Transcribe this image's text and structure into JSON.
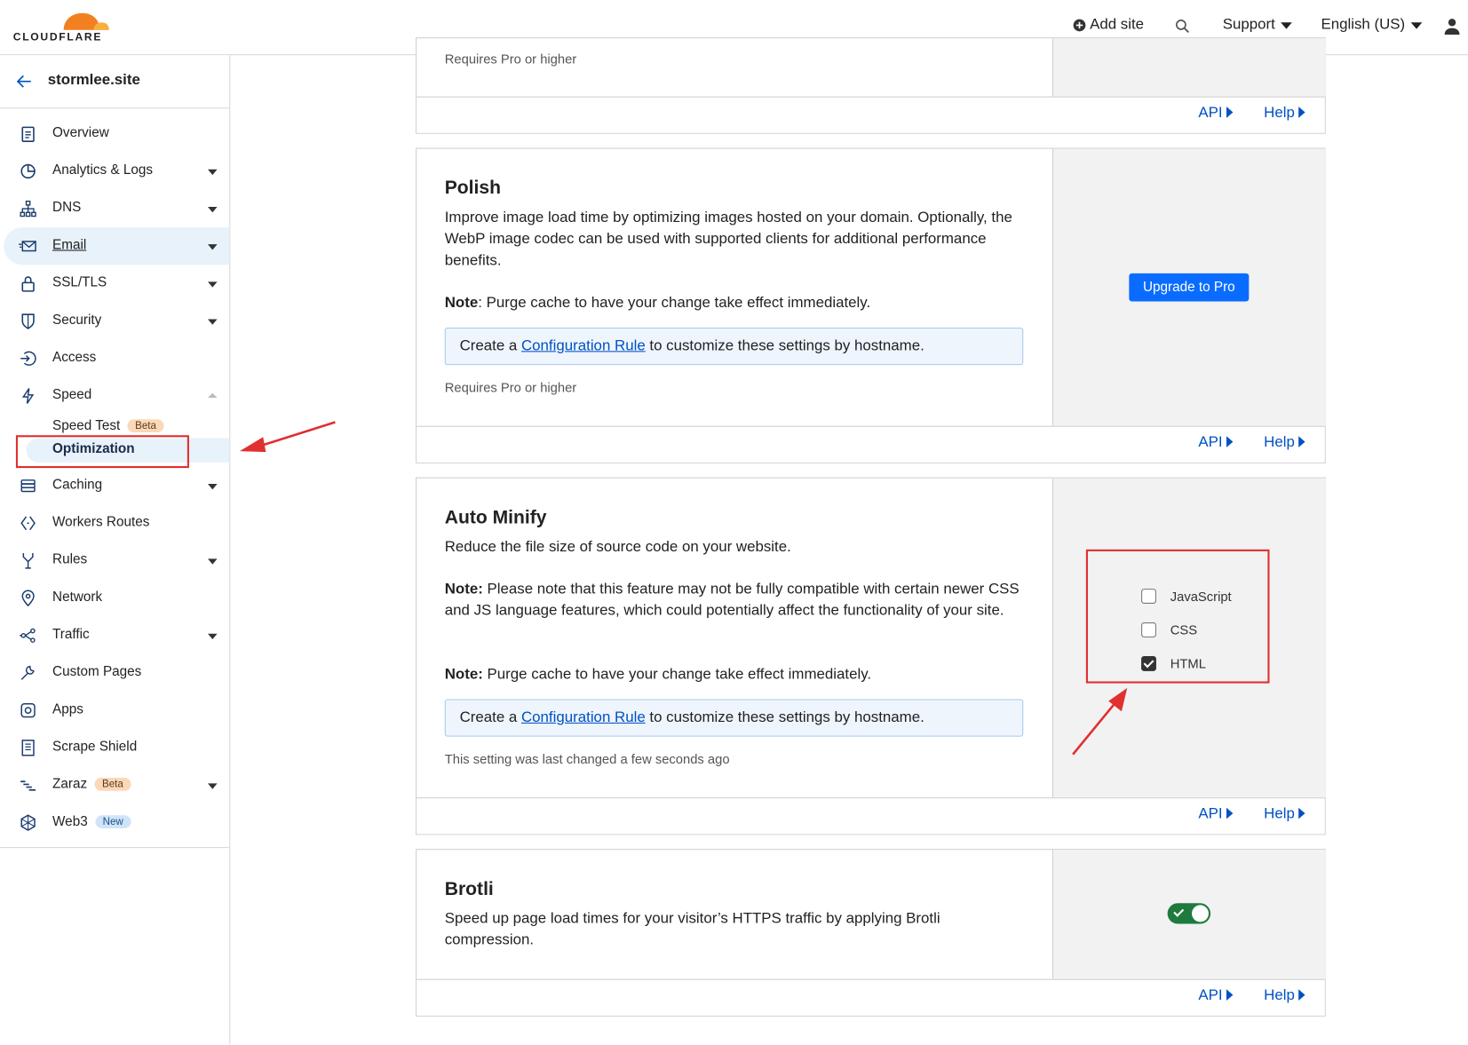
{
  "header": {
    "brand": "CLOUDFLARE",
    "add_site": "Add site",
    "support": "Support",
    "language": "English (US)"
  },
  "sidebar": {
    "site_name": "stormlee.site",
    "items": [
      {
        "label": "Overview",
        "icon": "clipboard-icon"
      },
      {
        "label": "Analytics & Logs",
        "icon": "pie-chart-icon"
      },
      {
        "label": "DNS",
        "icon": "network-tree-icon"
      },
      {
        "label": "Email",
        "icon": "envelope-icon"
      },
      {
        "label": "SSL/TLS",
        "icon": "lock-icon"
      },
      {
        "label": "Security",
        "icon": "shield-icon"
      },
      {
        "label": "Access",
        "icon": "access-icon"
      },
      {
        "label": "Speed",
        "icon": "lightning-icon"
      },
      {
        "label": "Caching",
        "icon": "server-stack-icon"
      },
      {
        "label": "Workers Routes",
        "icon": "workers-icon"
      },
      {
        "label": "Rules",
        "icon": "fork-icon"
      },
      {
        "label": "Network",
        "icon": "location-pin-icon"
      },
      {
        "label": "Traffic",
        "icon": "traffic-icon"
      },
      {
        "label": "Custom Pages",
        "icon": "wrench-icon"
      },
      {
        "label": "Apps",
        "icon": "apps-icon"
      },
      {
        "label": "Scrape Shield",
        "icon": "document-icon"
      },
      {
        "label": "Zaraz",
        "icon": "zaraz-icon"
      },
      {
        "label": "Web3",
        "icon": "web3-icon"
      }
    ],
    "speed_sub": {
      "speed_test": "Speed Test",
      "optimization": "Optimization"
    },
    "badges": {
      "beta": "Beta",
      "new": "New"
    }
  },
  "cards": {
    "top": {
      "requires": "Requires Pro or higher"
    },
    "polish": {
      "title": "Polish",
      "description": "Improve image load time by optimizing images hosted on your domain. Optionally, the WebP image codec can be used with supported clients for additional performance benefits.",
      "note_label": "Note",
      "note": ": Purge cache to have your change take effect immediately.",
      "rule_pre": "Create a ",
      "rule_link": "Configuration Rule",
      "rule_post": " to customize these settings by hostname.",
      "requires": "Requires Pro or higher",
      "upgrade": "Upgrade to Pro"
    },
    "minify": {
      "title": "Auto Minify",
      "description": "Reduce the file size of source code on your website.",
      "note1_label": "Note:",
      "note1": " Please note that this feature may not be fully compatible with certain newer CSS and JS language features, which could potentially affect the functionality of your site.",
      "note2_label": "Note:",
      "note2": " Purge cache to have your change take effect immediately.",
      "rule_pre": "Create a ",
      "rule_link": "Configuration Rule",
      "rule_post": " to customize these settings by hostname.",
      "changed": "This setting was last changed a few seconds ago",
      "options": [
        {
          "label": "JavaScript",
          "checked": false
        },
        {
          "label": "CSS",
          "checked": false
        },
        {
          "label": "HTML",
          "checked": true
        }
      ]
    },
    "brotli": {
      "title": "Brotli",
      "description": "Speed up page load times for your visitor’s HTTPS traffic by applying Brotli compression.",
      "enabled": true
    },
    "footer": {
      "api": "API",
      "help": "Help"
    }
  },
  "colors": {
    "accent": "#0051c3",
    "button": "#0a6cff",
    "toggle_on": "#1f7a3e",
    "highlight": "#e03030"
  }
}
